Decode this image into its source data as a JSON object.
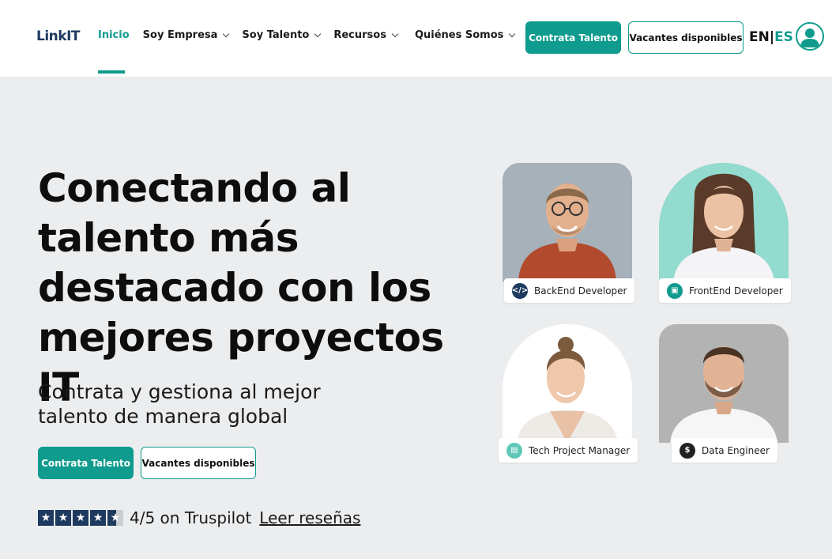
{
  "brand": {
    "logo_prefix": "Link",
    "logo_suffix": "IT"
  },
  "nav": {
    "items": [
      {
        "label": "Inicio",
        "active": true,
        "has_menu": false
      },
      {
        "label": "Soy Empresa",
        "active": false,
        "has_menu": true
      },
      {
        "label": "Soy Talento",
        "active": false,
        "has_menu": true
      },
      {
        "label": "Recursos",
        "active": false,
        "has_menu": true
      },
      {
        "label": "Quiénes Somos",
        "active": false,
        "has_menu": true
      }
    ],
    "primary_button": "Contrata Talento",
    "secondary_button": "Vacantes disponibles",
    "lang_en": "EN",
    "lang_sep": "|",
    "lang_es": "ES",
    "account_icon": "user-icon"
  },
  "hero": {
    "headline_lines": [
      "Conectando al",
      "talento más",
      "destacado con los",
      "mejores proyectos IT"
    ],
    "subline_lines": [
      "Contrata y gestiona al mejor",
      "talento de manera global"
    ],
    "primary_button": "Contrata Talento",
    "secondary_button": "Vacantes disponibles",
    "rating": {
      "stars": 4.5,
      "text": "4/5 on Truspilot",
      "link": "Leer reseñas"
    }
  },
  "profiles": [
    {
      "role": "BackEnd Developer",
      "icon": "code-icon",
      "icon_glyph": "</>",
      "icon_color": "#1e3a5f"
    },
    {
      "role": "FrontEnd Developer",
      "icon": "image-icon",
      "icon_glyph": "▣",
      "icon_color": "#0f9b8e"
    },
    {
      "role": "Tech Project Manager",
      "icon": "briefcase-icon",
      "icon_glyph": "▤",
      "icon_color": "#5fc7b8"
    },
    {
      "role": "Data Engineer",
      "icon": "dollar-icon",
      "icon_glyph": "$",
      "icon_color": "#222222"
    }
  ],
  "colors": {
    "accent": "#0f9b8e",
    "navy": "#1e3a5f",
    "hero_bg": "#ebedef"
  }
}
